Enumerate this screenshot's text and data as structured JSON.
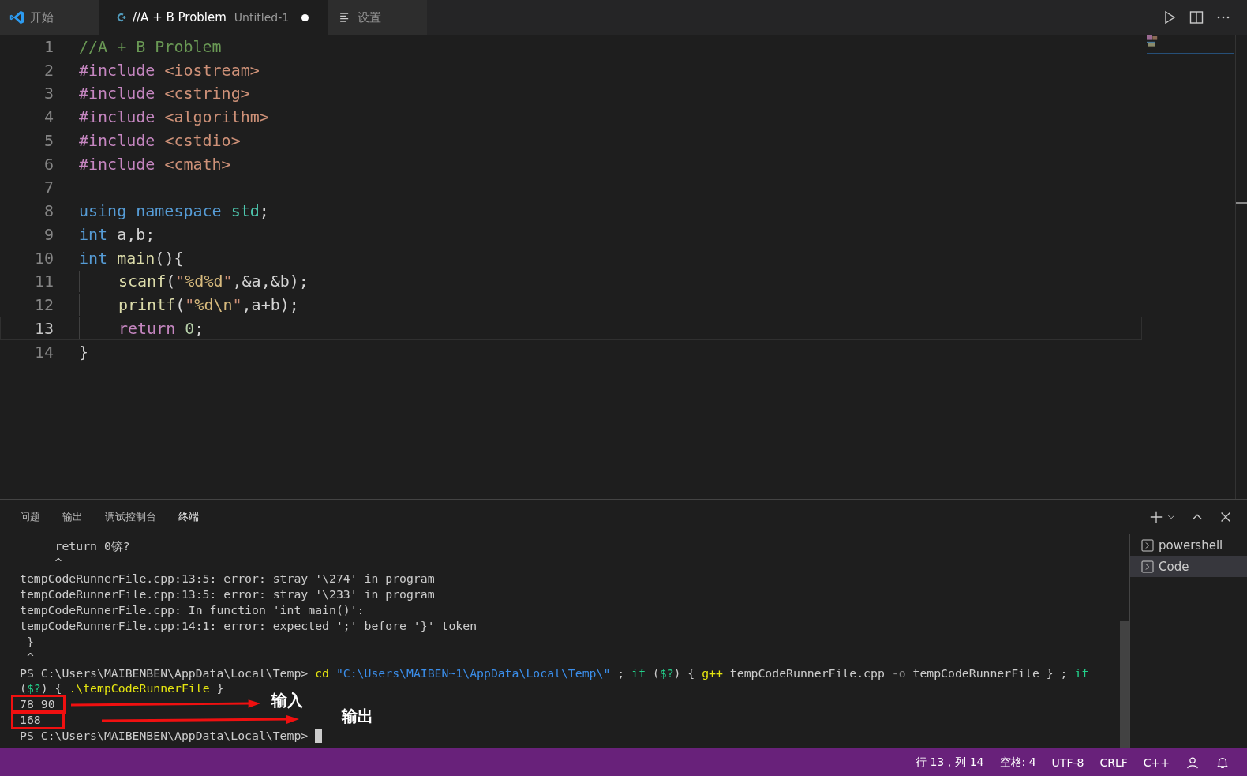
{
  "tabs": [
    {
      "kind": "welcome",
      "label": "开始",
      "selected": false,
      "dirty": false
    },
    {
      "kind": "cpp",
      "label": "//A + B Problem",
      "detail": "Untitled-1",
      "selected": true,
      "dirty": true
    },
    {
      "kind": "settings",
      "label": "设置",
      "selected": false,
      "dirty": false
    }
  ],
  "editor": {
    "lines": [
      {
        "number": "1",
        "current": false,
        "indented": false,
        "tokens": [
          {
            "kind": "comment",
            "t": "//A + B Problem"
          }
        ]
      },
      {
        "number": "2",
        "current": false,
        "indented": false,
        "tokens": [
          {
            "kind": "directive",
            "t": "#include "
          },
          {
            "kind": "string",
            "t": "<iostream>"
          }
        ]
      },
      {
        "number": "3",
        "current": false,
        "indented": false,
        "tokens": [
          {
            "kind": "directive",
            "t": "#include "
          },
          {
            "kind": "string",
            "t": "<cstring>"
          }
        ]
      },
      {
        "number": "4",
        "current": false,
        "indented": false,
        "tokens": [
          {
            "kind": "directive",
            "t": "#include "
          },
          {
            "kind": "string",
            "t": "<algorithm>"
          }
        ]
      },
      {
        "number": "5",
        "current": false,
        "indented": false,
        "tokens": [
          {
            "kind": "directive",
            "t": "#include "
          },
          {
            "kind": "string",
            "t": "<cstdio>"
          }
        ]
      },
      {
        "number": "6",
        "current": false,
        "indented": false,
        "tokens": [
          {
            "kind": "directive",
            "t": "#include "
          },
          {
            "kind": "string",
            "t": "<cmath>"
          }
        ]
      },
      {
        "number": "7",
        "current": false,
        "indented": false
      },
      {
        "number": "8",
        "current": false,
        "indented": false,
        "tokens": [
          {
            "kind": "keyword",
            "t": "using namespace "
          },
          {
            "kind": "type",
            "t": "std"
          },
          {
            "kind": "plain",
            "t": ";"
          }
        ]
      },
      {
        "number": "9",
        "current": false,
        "indented": false,
        "tokens": [
          {
            "kind": "keyword",
            "t": "int "
          },
          {
            "kind": "plain",
            "t": "a,b;"
          }
        ]
      },
      {
        "number": "10",
        "current": false,
        "indented": false,
        "tokens": [
          {
            "kind": "keyword",
            "t": "int "
          },
          {
            "kind": "function",
            "t": "main"
          },
          {
            "kind": "plain",
            "t": "(){"
          }
        ]
      },
      {
        "number": "11",
        "current": false,
        "indented": true,
        "tokens": [
          {
            "kind": "function",
            "t": "scanf"
          },
          {
            "kind": "plain",
            "t": "("
          },
          {
            "kind": "string",
            "t": "\""
          },
          {
            "kind": "escape",
            "t": "%d%d"
          },
          {
            "kind": "string",
            "t": "\""
          },
          {
            "kind": "plain",
            "t": ",&a,&b);"
          }
        ]
      },
      {
        "number": "12",
        "current": false,
        "indented": true,
        "tokens": [
          {
            "kind": "function",
            "t": "printf"
          },
          {
            "kind": "plain",
            "t": "("
          },
          {
            "kind": "string",
            "t": "\""
          },
          {
            "kind": "escape",
            "t": "%d\\n"
          },
          {
            "kind": "string",
            "t": "\""
          },
          {
            "kind": "plain",
            "t": ",a+b);"
          }
        ]
      },
      {
        "number": "13",
        "current": true,
        "indented": true,
        "tokens": [
          {
            "kind": "control",
            "t": "return "
          },
          {
            "kind": "number",
            "t": "0"
          },
          {
            "kind": "plain",
            "t": ";"
          }
        ]
      },
      {
        "number": "14",
        "current": false,
        "indented": false,
        "tokens": [
          {
            "kind": "plain",
            "t": "}"
          }
        ]
      }
    ]
  },
  "panel": {
    "tabs": [
      {
        "label": "问题",
        "selected": false
      },
      {
        "label": "输出",
        "selected": false
      },
      {
        "label": "调试控制台",
        "selected": false
      },
      {
        "label": "终端",
        "selected": true
      }
    ],
    "terminal": {
      "lines": [
        {
          "tokens": [
            {
              "kind": "plain",
              "t": "     return 0锛?"
            }
          ]
        },
        {
          "tokens": [
            {
              "kind": "plain",
              "t": "     ^"
            }
          ]
        },
        {
          "tokens": [
            {
              "kind": "plain",
              "t": "tempCodeRunnerFile.cpp:13:5: error: stray '\\274' in program"
            }
          ]
        },
        {
          "tokens": [
            {
              "kind": "plain",
              "t": "tempCodeRunnerFile.cpp:13:5: error: stray '\\233' in program"
            }
          ]
        },
        {
          "tokens": [
            {
              "kind": "plain",
              "t": "tempCodeRunnerFile.cpp: In function 'int main()':"
            }
          ]
        },
        {
          "tokens": [
            {
              "kind": "plain",
              "t": "tempCodeRunnerFile.cpp:14:1: error: expected ';' before '}' token"
            }
          ]
        },
        {
          "tokens": [
            {
              "kind": "plain",
              "t": " }"
            }
          ]
        },
        {
          "tokens": [
            {
              "kind": "plain",
              "t": " ^"
            }
          ]
        },
        {
          "tokens": [
            {
              "kind": "plain",
              "t": "PS C:\\Users\\MAIBENBEN\\AppData\\Local\\Temp> "
            },
            {
              "kind": "command",
              "t": "cd "
            },
            {
              "kind": "string",
              "t": "\"C:\\Users\\MAIBEN~1\\AppData\\Local\\Temp\\\""
            },
            {
              "kind": "plain",
              "t": " ; "
            },
            {
              "kind": "keyword",
              "t": "if"
            },
            {
              "kind": "plain",
              "t": " ("
            },
            {
              "kind": "keyword",
              "t": "$?"
            },
            {
              "kind": "plain",
              "t": ") { "
            },
            {
              "kind": "command",
              "t": "g++"
            },
            {
              "kind": "plain",
              "t": " tempCodeRunnerFile.cpp "
            },
            {
              "kind": "param",
              "t": "-o"
            },
            {
              "kind": "plain",
              "t": " tempCodeRunnerFile } ; "
            },
            {
              "kind": "keyword",
              "t": "if"
            }
          ]
        },
        {
          "tokens": [
            {
              "kind": "plain",
              "t": "("
            },
            {
              "kind": "keyword",
              "t": "$?"
            },
            {
              "kind": "plain",
              "t": ") { "
            },
            {
              "kind": "command",
              "t": ".\\tempCodeRunnerFile"
            },
            {
              "kind": "plain",
              "t": " }"
            }
          ]
        },
        {
          "tokens": [
            {
              "kind": "plain",
              "t": "78 90"
            }
          ],
          "note": "输入"
        },
        {
          "tokens": [
            {
              "kind": "plain",
              "t": "168"
            }
          ],
          "note": "输出"
        },
        {
          "tokens": [
            {
              "kind": "plain",
              "t": "PS C:\\Users\\MAIBENBEN\\AppData\\Local\\Temp> "
            }
          ],
          "cursor": true
        }
      ]
    },
    "sessions": [
      {
        "label": "powershell",
        "selected": false
      },
      {
        "label": "Code",
        "selected": true
      }
    ]
  },
  "status_bar": {
    "items": [
      "行 13，列 14",
      "空格: 4",
      "UTF-8",
      "CRLF",
      "C++"
    ]
  }
}
